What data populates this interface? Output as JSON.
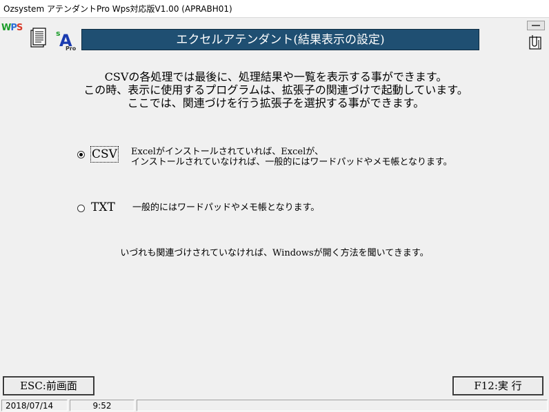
{
  "window": {
    "title": "Ozsystem アテンダントPro Wps対応版V1.00 (APRABH01)"
  },
  "logos": {
    "wps_letters": [
      "W",
      "P",
      "S"
    ],
    "sa_letters": {
      "s": "s",
      "a": "A",
      "pro": "Pro"
    }
  },
  "header": {
    "title": "エクセルアテンダント(結果表示の設定)"
  },
  "description": {
    "lines": [
      "CSVの各処理では最後に、処理結果や一覧を表示する事ができます。",
      "この時、表示に使用するプログラムは、拡張子の関連づけで起動しています。",
      "ここでは、関連づけを行う拡張子を選択する事ができます。"
    ]
  },
  "options": {
    "csv": {
      "label": "CSV",
      "checked": true,
      "desc_line1": "Excelがインストールされていれば、Excelが、",
      "desc_line2": "インストールされていなければ、一般的にはワードパッドやメモ帳となります。"
    },
    "txt": {
      "label": "TXT",
      "checked": false,
      "desc": "一般的にはワードパッドやメモ帳となります。"
    }
  },
  "note": "いづれも関連づけされていなければ、Windowsが開く方法を聞いてきます。",
  "buttons": {
    "esc": "ESC:前画面",
    "f12": "F12:実 行"
  },
  "status": {
    "date": "2018/07/14",
    "time": "9:52"
  },
  "colors": {
    "banner": "#1f4f72",
    "background": "#f0f0f0"
  },
  "icons": {
    "doc": "document-icon",
    "clip": "clipboard-icon",
    "mini": "minimize-icon"
  }
}
